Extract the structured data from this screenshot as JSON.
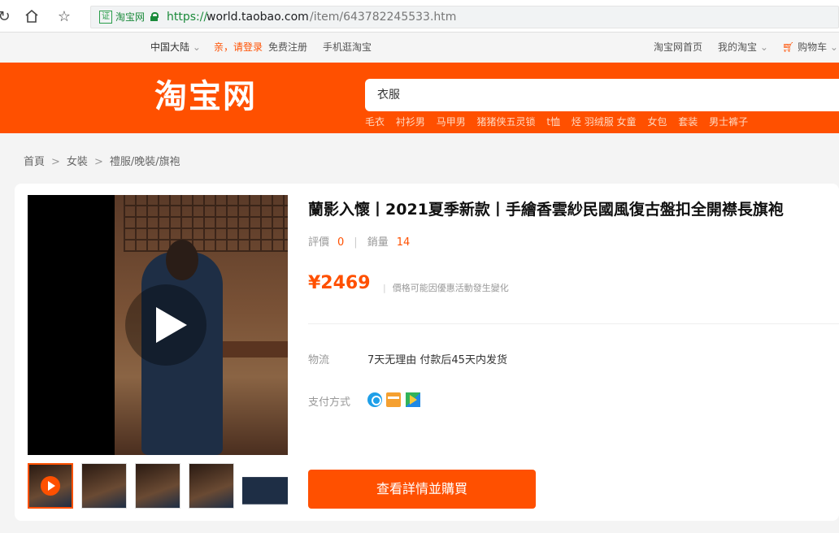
{
  "browser": {
    "back_icon": "reload-icon",
    "home_icon": "home-icon",
    "star_icon": "star-icon",
    "cert_label": "证",
    "site_label": "淘宝网",
    "url_protocol": "https://",
    "url_host": "world.taobao.com",
    "url_path": "/item/643782245533.htm"
  },
  "sitebar": {
    "region": "中国大陆",
    "login": "亲，请登录",
    "register": "免费注册",
    "mobile": "手机逛淘宝",
    "home": "淘宝网首页",
    "my_taobao": "我的淘宝",
    "cart": "购物车"
  },
  "header": {
    "logo": "淘宝网",
    "search_value": "衣服",
    "hot_words": [
      "毛衣",
      "衬衫男",
      "马甲男",
      "猪猪侠五灵锁",
      "t恤",
      "烃 羽绒服 女童",
      "女包",
      "套装",
      "男士裤子"
    ]
  },
  "breadcrumb": [
    "首頁",
    "女裝",
    "禮服/晚裝/旗袍"
  ],
  "product": {
    "title": "蘭影入懷丨2021夏季新款丨手繪香雲紗民國風復古盤扣全開襟長旗袍",
    "reviews_label": "評價",
    "reviews_count": "0",
    "sales_label": "銷量",
    "sales_count": "14",
    "price": "¥2469",
    "price_note": "價格可能因優惠活動發生變化",
    "shipping_label": "物流",
    "shipping_value": "7天无理由 付款后45天内发货",
    "payment_label": "支付方式",
    "payment_icons": [
      "alipay-icon",
      "bank-card-icon",
      "google-play-icon"
    ],
    "buy_button": "查看詳情並購買"
  },
  "colors": {
    "brand_orange": "#ff5000"
  }
}
